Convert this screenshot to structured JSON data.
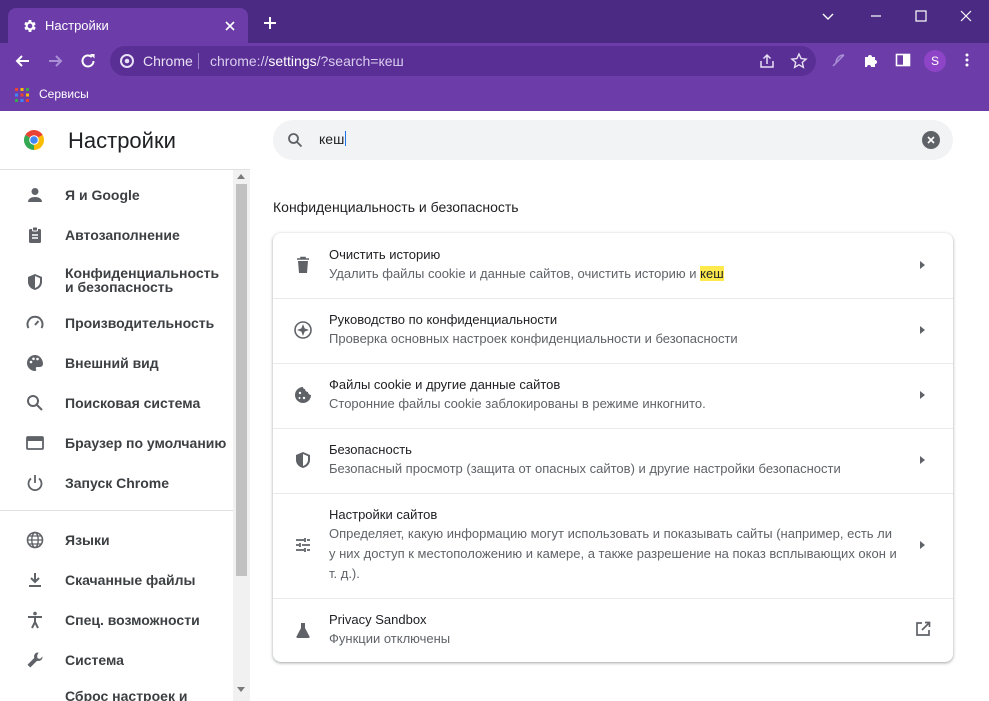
{
  "window": {
    "tab_title": "Настройки",
    "new_tab_symbol": "+"
  },
  "toolbar": {
    "omnibox_site": "Chrome",
    "url_prefix": "chrome://",
    "url_host": "settings",
    "url_rest": "/?search=кеш",
    "profile_initial": "S"
  },
  "bookmarks": {
    "apps_label": "Сервисы"
  },
  "settings": {
    "title": "Настройки",
    "search_value": "кеш"
  },
  "sidebar": {
    "items": [
      {
        "label": "Я и Google",
        "icon": "person-icon"
      },
      {
        "label": "Автозаполнение",
        "icon": "clipboard-icon"
      },
      {
        "label": "Конфиденциальность и безопасность",
        "icon": "shield-icon"
      },
      {
        "label": "Производительность",
        "icon": "speedometer-icon"
      },
      {
        "label": "Внешний вид",
        "icon": "palette-icon"
      },
      {
        "label": "Поисковая система",
        "icon": "search-icon"
      },
      {
        "label": "Браузер по умолчанию",
        "icon": "browser-window-icon"
      },
      {
        "label": "Запуск Chrome",
        "icon": "power-icon"
      },
      {
        "label": "Языки",
        "icon": "globe-icon"
      },
      {
        "label": "Скачанные файлы",
        "icon": "download-icon"
      },
      {
        "label": "Спец. возможности",
        "icon": "accessibility-icon"
      },
      {
        "label": "Система",
        "icon": "wrench-icon"
      },
      {
        "label": "Сброс настроек и",
        "icon": "reset-icon"
      }
    ]
  },
  "main": {
    "section_title": "Конфиденциальность и безопасность",
    "rows": [
      {
        "title": "Очистить историю",
        "subtitle": "Удалить файлы cookie и данные сайтов, очистить историю и ",
        "highlight": "кеш",
        "icon": "trash-icon"
      },
      {
        "title": "Руководство по конфиденциальности",
        "subtitle": "Проверка основных настроек конфиденциальности и безопасности",
        "icon": "compass-icon"
      },
      {
        "title": "Файлы cookie и другие данные сайтов",
        "subtitle": "Сторонние файлы cookie заблокированы в режиме инкогнито.",
        "icon": "cookie-icon"
      },
      {
        "title": "Безопасность",
        "subtitle": "Безопасный просмотр (защита от опасных сайтов) и другие настройки безопасности",
        "icon": "shield-icon"
      },
      {
        "title": "Настройки сайтов",
        "subtitle": "Определяет, какую информацию могут использовать и показывать сайты (например, есть ли у них доступ к местоположению и камере, а также разрешение на показ всплывающих окон и т. д.).",
        "icon": "tune-icon"
      },
      {
        "title": "Privacy Sandbox",
        "subtitle": "Функции отключены",
        "icon": "flask-icon"
      }
    ]
  },
  "colors": {
    "tabbar": "#4a2a82",
    "toolbar": "#6c3ca8",
    "highlight": "#ffe94d"
  }
}
